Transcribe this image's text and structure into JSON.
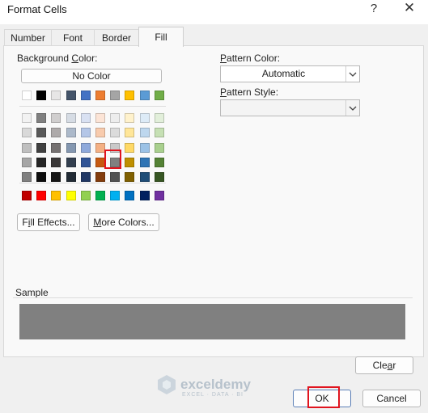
{
  "window": {
    "title": "Format Cells",
    "help": "?",
    "close": "✕"
  },
  "tabs": [
    {
      "label": "Number"
    },
    {
      "label": "Font"
    },
    {
      "label": "Border"
    },
    {
      "label": "Fill",
      "active": true
    }
  ],
  "fill": {
    "background_color_label": "Background Color:",
    "no_color_label": "No Color",
    "fill_effects_label": "Fill Effects...",
    "more_colors_label": "More Colors...",
    "pattern_color_label": "Pattern Color:",
    "pattern_color_value": "Automatic",
    "pattern_style_label": "Pattern Style:",
    "pattern_style_value": "",
    "sample_label": "Sample",
    "sample_color": "#808080",
    "clear_label": "Clear",
    "selected_color": "#808080",
    "theme_row": [
      "#ffffff",
      "#000000",
      "#e7e6e6",
      "#44546a",
      "#4472c4",
      "#ed7d31",
      "#a5a5a5",
      "#ffc000",
      "#5b9bd5",
      "#70ad47"
    ],
    "tint_rows": [
      [
        "#f2f2f2",
        "#808080",
        "#d0cece",
        "#d6dce4",
        "#d9e1f2",
        "#fce4d6",
        "#ededed",
        "#fff2cc",
        "#ddebf7",
        "#e2efda"
      ],
      [
        "#d9d9d9",
        "#595959",
        "#aeaaaa",
        "#acb9ca",
        "#b4c6e7",
        "#f8cbad",
        "#dbdbdb",
        "#ffe699",
        "#bdd7ee",
        "#c6e0b4"
      ],
      [
        "#bfbfbf",
        "#404040",
        "#757171",
        "#8497b0",
        "#8ea9db",
        "#f4b084",
        "#c9c9c9",
        "#ffd966",
        "#9bc2e6",
        "#a9d08e"
      ],
      [
        "#a6a6a6",
        "#262626",
        "#3a3838",
        "#333f4f",
        "#305496",
        "#c65911",
        "#808080",
        "#bf8f00",
        "#2f75b5",
        "#548235"
      ],
      [
        "#808080",
        "#0d0d0d",
        "#161616",
        "#222b35",
        "#203764",
        "#833c0c",
        "#525252",
        "#806000",
        "#1f4e78",
        "#375623"
      ]
    ],
    "standard_row": [
      "#c00000",
      "#ff0000",
      "#ffc000",
      "#ffff00",
      "#92d050",
      "#00b050",
      "#00b0f0",
      "#0070c0",
      "#002060",
      "#7030a0"
    ]
  },
  "footer": {
    "ok_label": "OK",
    "cancel_label": "Cancel"
  },
  "watermark": {
    "name": "exceldemy",
    "tagline": "EXCEL · DATA · BI"
  }
}
